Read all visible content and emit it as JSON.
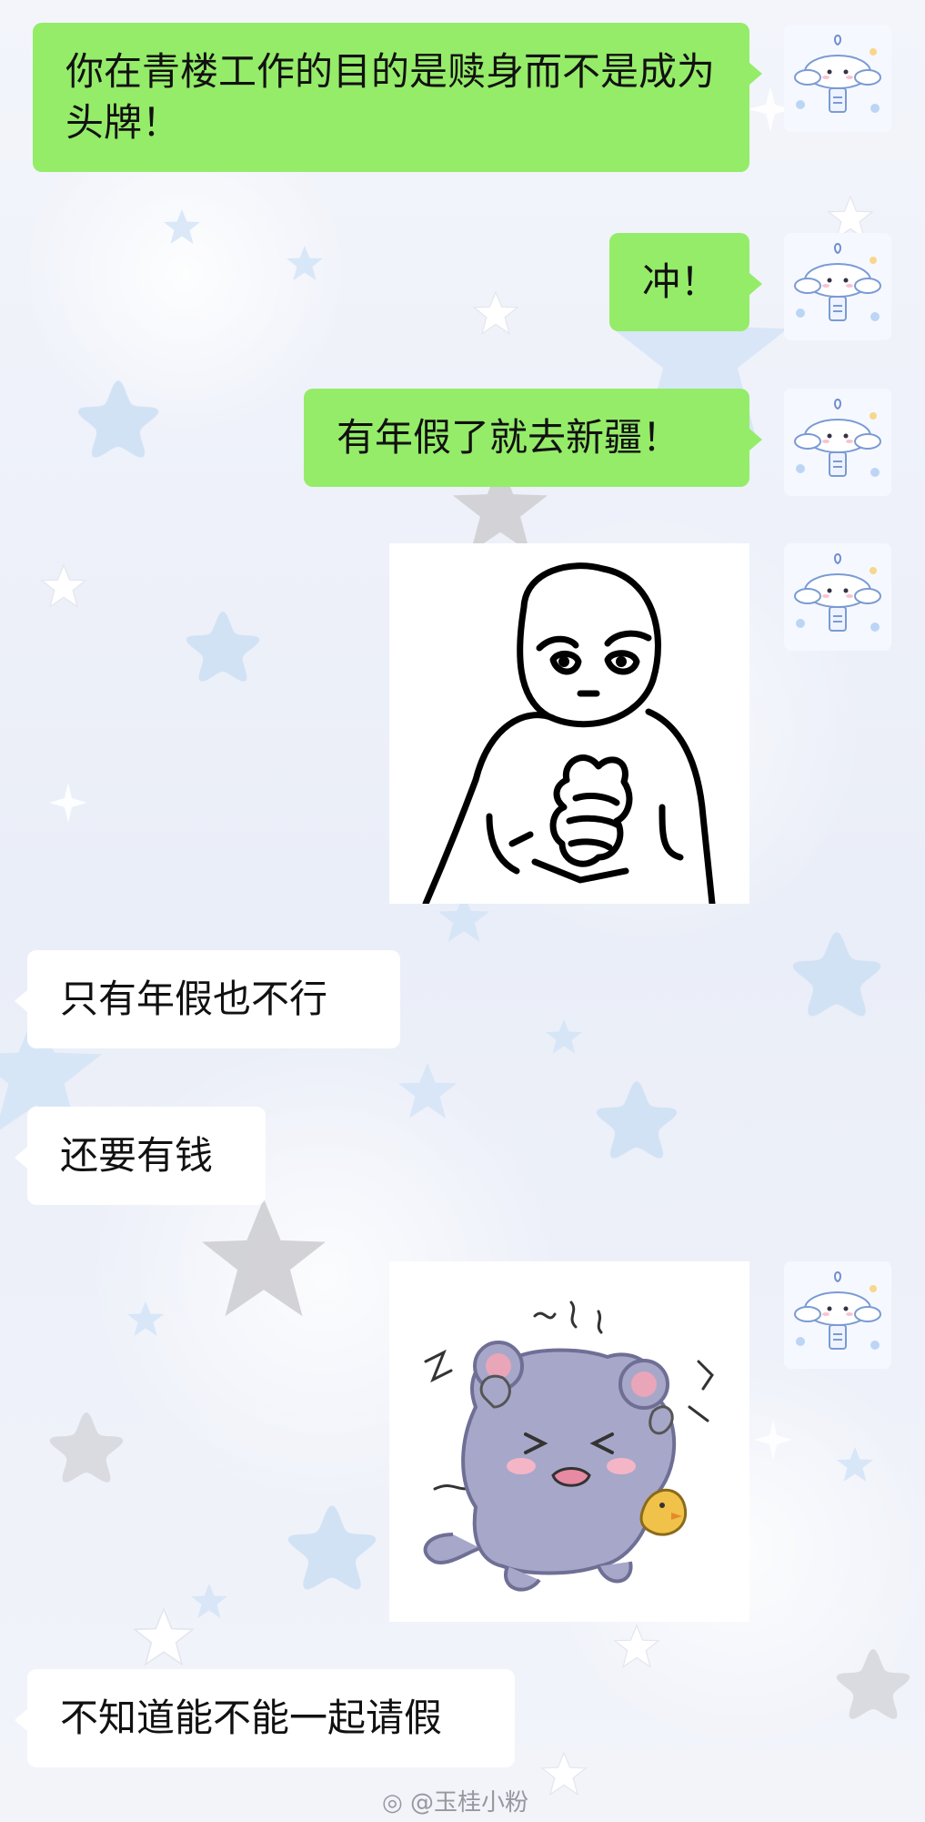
{
  "messages": [
    {
      "side": "right",
      "text": "你在青楼工作的目的是赎身而不是成为头牌！"
    },
    {
      "side": "right",
      "text": "冲！"
    },
    {
      "side": "right",
      "text": "有年假了就去新疆！"
    },
    {
      "side": "right",
      "type": "sticker",
      "sticker": "determined-face-hands-clasped"
    },
    {
      "side": "left",
      "text": "只有年假也不行"
    },
    {
      "side": "left",
      "text": "还要有钱"
    },
    {
      "side": "right",
      "type": "sticker",
      "sticker": "distressed-gray-mouse"
    },
    {
      "side": "left",
      "text": "不知道能不能一起请假"
    }
  ],
  "avatar": {
    "icon": "cinnamoroll-charm-icon"
  },
  "watermark": {
    "text": "@玉桂小粉"
  },
  "colors": {
    "sent_bubble": "#95ec69",
    "received_bubble": "#ffffff"
  }
}
